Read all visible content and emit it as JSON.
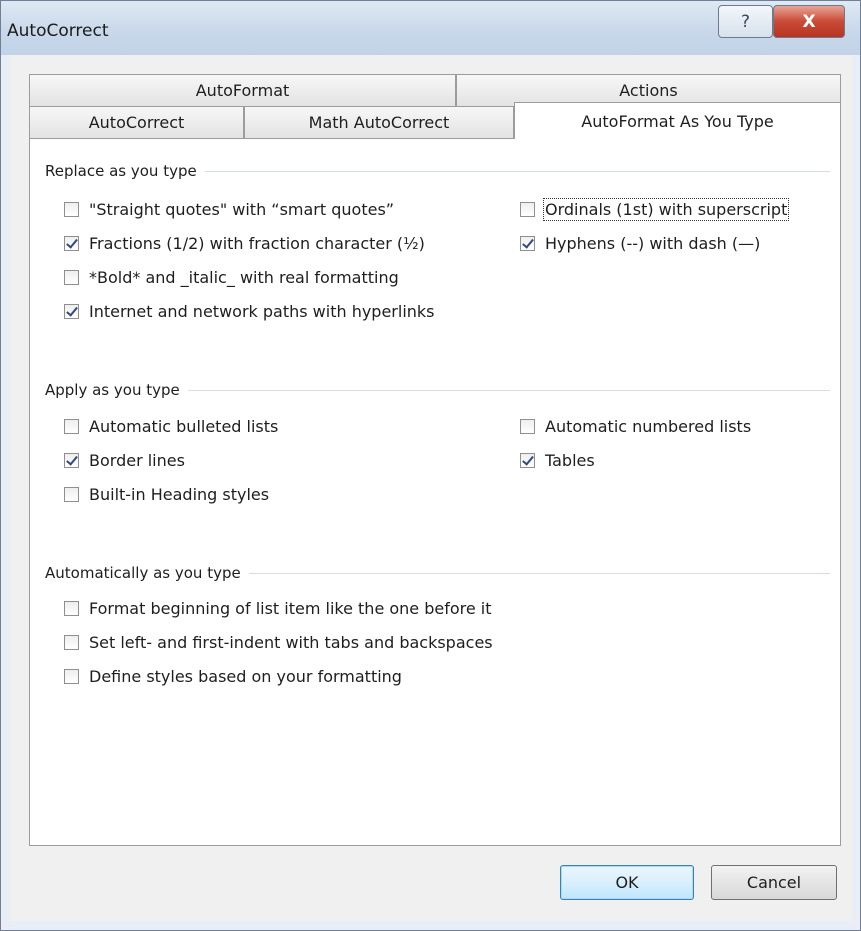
{
  "window": {
    "title": "AutoCorrect",
    "help_glyph": "?",
    "close_glyph": "X"
  },
  "tabs": {
    "autoformat": "AutoFormat",
    "actions": "Actions",
    "autocorrect": "AutoCorrect",
    "math_autocorrect": "Math AutoCorrect",
    "autoformat_as_you_type": "AutoFormat As You Type",
    "active": "AutoFormat As You Type"
  },
  "replace_group": {
    "label": "Replace as you type",
    "items": [
      {
        "label": "\"Straight quotes\" with “smart quotes”",
        "checked": false
      },
      {
        "label": "Ordinals (1st) with superscript",
        "checked": false
      },
      {
        "label": "Fractions (1/2) with fraction character (½)",
        "checked": true
      },
      {
        "label": "Hyphens (--) with dash (—)",
        "checked": true
      },
      {
        "label": "*Bold* and _italic_ with real formatting",
        "checked": false
      },
      {
        "label": "Internet and network paths with hyperlinks",
        "checked": true
      }
    ]
  },
  "apply_group": {
    "label": "Apply as you type",
    "items": [
      {
        "label": "Automatic bulleted lists",
        "checked": false
      },
      {
        "label": "Automatic numbered lists",
        "checked": false
      },
      {
        "label": "Border lines",
        "checked": true
      },
      {
        "label": "Tables",
        "checked": true
      },
      {
        "label": "Built-in Heading styles",
        "checked": false
      }
    ]
  },
  "auto_group": {
    "label": "Automatically as you type",
    "items": [
      {
        "label": "Format beginning of list item like the one before it",
        "checked": false
      },
      {
        "label": "Set left- and first-indent with tabs and backspaces",
        "checked": false
      },
      {
        "label": "Define styles based on your formatting",
        "checked": false
      }
    ]
  },
  "buttons": {
    "ok": "OK",
    "cancel": "Cancel"
  }
}
